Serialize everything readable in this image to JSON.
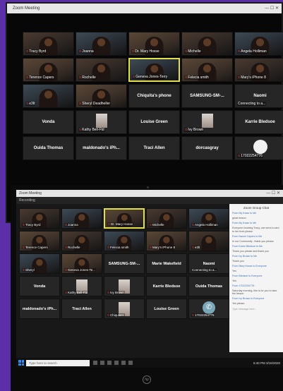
{
  "top_window": {
    "title": "Zoom Meeting",
    "tiles": [
      {
        "name": "Tracy Byrd",
        "kind": "video"
      },
      {
        "name": "Joanna",
        "kind": "video"
      },
      {
        "name": "Dr. Mary Hosse",
        "kind": "video"
      },
      {
        "name": "Michelle",
        "kind": "video"
      },
      {
        "name": "Angela Holliman",
        "kind": "video"
      },
      {
        "name": "Terence Capers",
        "kind": "video"
      },
      {
        "name": "Rochelle",
        "kind": "video"
      },
      {
        "name": "Geneva Jones-Terry",
        "kind": "video",
        "active": true
      },
      {
        "name": "Felecia smith",
        "kind": "video"
      },
      {
        "name": "Mary's iPhone 8",
        "kind": "video"
      },
      {
        "name": "e3lt",
        "kind": "video"
      },
      {
        "name": "Sheryl Deadheller",
        "kind": "video"
      },
      {
        "name": "Chiquita's phone",
        "kind": "name"
      },
      {
        "name": "SAMSUNG-SM-...",
        "kind": "name"
      },
      {
        "name": "Naomi",
        "kind": "name",
        "sub": "Connecting to a..."
      },
      {
        "name": "Vonda",
        "kind": "name"
      },
      {
        "name": "Kathy Bell-Ftd",
        "kind": "avatar"
      },
      {
        "name": "Louise Green",
        "kind": "name"
      },
      {
        "name": "Ivy Brown",
        "kind": "avatar"
      },
      {
        "name": "Karrie Bledsoe",
        "kind": "name"
      },
      {
        "name": "Ouida Thomas",
        "kind": "name"
      },
      {
        "name": "maldonado's iPh...",
        "kind": "name"
      },
      {
        "name": "Traci Allen",
        "kind": "name"
      },
      {
        "name": "dorcasgray",
        "kind": "name"
      },
      {
        "name": "17022254776",
        "kind": "round"
      }
    ]
  },
  "bottom_window": {
    "title": "Zoom Meeting",
    "recording_label": "Recording",
    "tiles": [
      {
        "name": "Tracy Byrd",
        "kind": "video"
      },
      {
        "name": "Joanna",
        "kind": "video"
      },
      {
        "name": "Dr. Mary Hosse",
        "kind": "video",
        "active": true
      },
      {
        "name": "Michelle",
        "kind": "video"
      },
      {
        "name": "Angela Holliman",
        "kind": "video"
      },
      {
        "name": "Terence Capers",
        "kind": "video"
      },
      {
        "name": "Rochelle",
        "kind": "video"
      },
      {
        "name": "Felecia smith",
        "kind": "video"
      },
      {
        "name": "Mary's iPhone 8",
        "kind": "video"
      },
      {
        "name": "e3lt",
        "kind": "video"
      },
      {
        "name": "Sheryl",
        "kind": "video"
      },
      {
        "name": "Geneva Jones-Te...",
        "kind": "video"
      },
      {
        "name": "SAMSUNG-SM-...",
        "kind": "name"
      },
      {
        "name": "Marie Wakefield",
        "kind": "name"
      },
      {
        "name": "Naomi",
        "kind": "name",
        "sub": "Connecting to a..."
      },
      {
        "name": "Vonda",
        "kind": "name"
      },
      {
        "name": "Kathy Bell-Ftd",
        "kind": "avatar"
      },
      {
        "name": "Ivy Brown",
        "kind": "avatar"
      },
      {
        "name": "Karrie Bledsoe",
        "kind": "name"
      },
      {
        "name": "Ouida Thomas",
        "kind": "name"
      },
      {
        "name": "maldonado's iPh...",
        "kind": "name"
      },
      {
        "name": "Traci Allen",
        "kind": "name"
      },
      {
        "name": "Chiquita's",
        "kind": "avatar"
      },
      {
        "name": "Louise Green",
        "kind": "name"
      },
      {
        "name": "17022254776",
        "kind": "phone"
      }
    ],
    "chat": {
      "title": "Zoom Group Chat",
      "messages": [
        {
          "from": "From My Kwan to Me",
          "text": "great lesson"
        },
        {
          "from": "From My Kwan to Me",
          "text": "Everyone knowing Tracy, can send a card to her front please"
        },
        {
          "from": "From Naomi Capers to Me",
          "text": "In our Community - thank you please"
        },
        {
          "from": "From Karrie Bledsoe to Me",
          "text": "Thank you please and thank you"
        },
        {
          "from": "From Ivy Brown to Me",
          "text": "Thank you"
        },
        {
          "from": "From Mary Hosse to Everyone",
          "text": "Yes"
        },
        {
          "from": "From Bledsoe to Everyone",
          "text": "Yes"
        },
        {
          "from": "From 17022254776",
          "text": "Saturday morning, this is for you to take the lesson"
        },
        {
          "from": "From Ivy Brown to Everyone",
          "text": "Yes please"
        }
      ],
      "placeholder": "Type message here..."
    },
    "taskbar": {
      "search_placeholder": "Type here to search",
      "time": "5:40 PM",
      "date": "3/16/2020"
    }
  },
  "colors": {
    "background": "#5b2fa8",
    "active_speaker_border": "#e2e04a",
    "muted_icon": "#e04646"
  }
}
